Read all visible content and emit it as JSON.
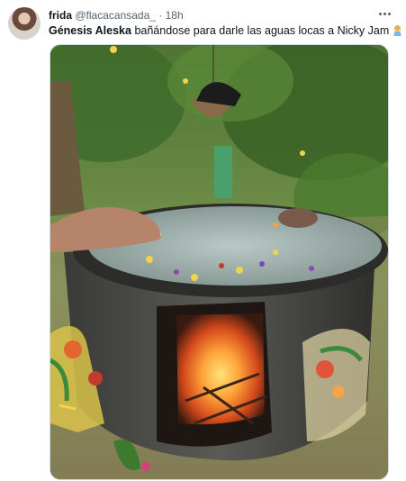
{
  "author": {
    "display_name": "frida",
    "handle": "@flacacansada_",
    "separator": "·",
    "time": "18h"
  },
  "tweet": {
    "text_bold": "Génesis Aleska",
    "text_rest": " bañándose para darle las aguas locas a Nicky Jam",
    "emoji": "woman-facepalming-emoji"
  },
  "icons": {
    "more": "more-horizontal-icon"
  },
  "colors": {
    "name": "#0f1419",
    "secondary": "#536471",
    "border": "#cfd9de"
  }
}
